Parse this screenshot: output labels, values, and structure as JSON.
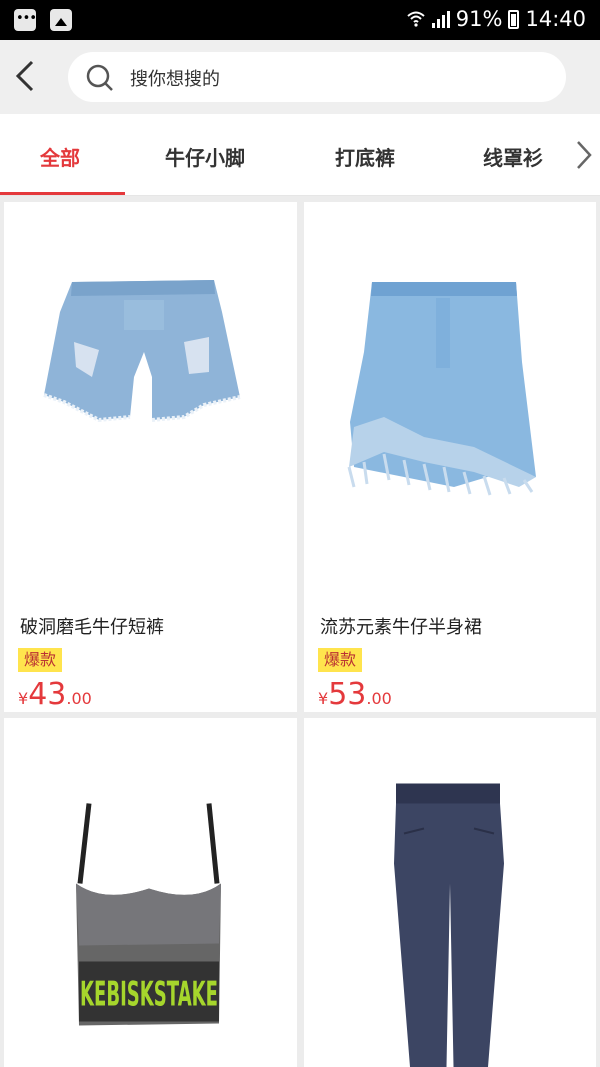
{
  "status_bar": {
    "battery": "91%",
    "time": "14:40"
  },
  "header": {
    "search_placeholder": "搜你想搜的"
  },
  "tabs": [
    {
      "label": "全部",
      "active": true
    },
    {
      "label": "牛仔小脚",
      "active": false
    },
    {
      "label": "打底裤",
      "active": false
    },
    {
      "label": "线罩衫",
      "active": false
    }
  ],
  "products": [
    {
      "title": "破洞磨毛牛仔短裤",
      "tag": "爆款",
      "currency": "¥",
      "price_int": "43",
      "price_dec": ".00",
      "image": "denim-shorts"
    },
    {
      "title": "流苏元素牛仔半身裙",
      "tag": "爆款",
      "currency": "¥",
      "price_int": "53",
      "price_dec": ".00",
      "image": "denim-fringe-skirt"
    },
    {
      "title": "",
      "tag": "",
      "currency": "",
      "price_int": "",
      "price_dec": "",
      "image": "sport-bra",
      "print_text": "KEBISKSTAKE"
    },
    {
      "title": "",
      "tag": "",
      "currency": "",
      "price_int": "",
      "price_dec": "",
      "image": "dark-leggings"
    }
  ],
  "colors": {
    "accent": "#e4393c",
    "tag_bg": "#ffe44d",
    "denim": "#8fb4d8",
    "bra_green": "#a6d62c"
  }
}
